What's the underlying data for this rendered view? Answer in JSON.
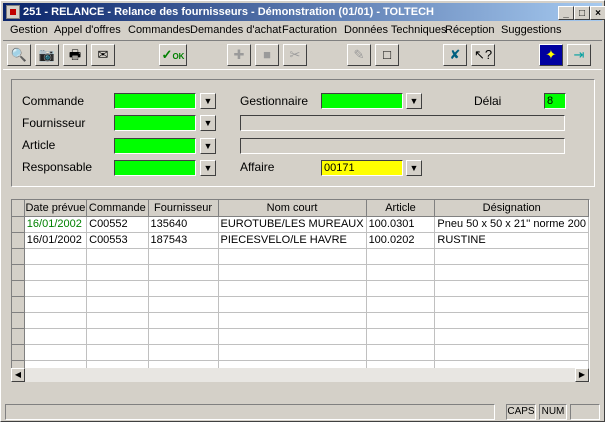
{
  "window": {
    "title": "251 - RELANCE - Relance des fournisseurs - Démonstration (01/01) - TOLTECH"
  },
  "menu": [
    "Gestion",
    "Appel d'offres",
    "Commandes",
    "Demandes d'achat",
    "Facturation",
    "Données Techniques",
    "Réception",
    "Suggestions"
  ],
  "toolbar": {
    "icons": [
      "preview-icon",
      "camera-icon",
      "print-icon",
      "mail-icon",
      "ok-icon",
      "add-icon",
      "stop-icon",
      "cut-icon",
      "edit-icon",
      "new-icon",
      "tools-icon",
      "help-icon",
      "scene-icon",
      "exit-icon"
    ],
    "ok_label": "OK"
  },
  "form": {
    "commande_label": "Commande",
    "fournisseur_label": "Fournisseur",
    "article_label": "Article",
    "responsable_label": "Responsable",
    "gestionnaire_label": "Gestionnaire",
    "affaire_label": "Affaire",
    "affaire_value": "00171",
    "delai_label": "Délai",
    "delai_value": "8"
  },
  "table": {
    "columns": [
      "Date prévue",
      "Commande",
      "Fournisseur",
      "Nom court",
      "Article",
      "Désignation"
    ],
    "rows": [
      [
        "16/01/2002",
        "C00552",
        "135640",
        "EUROTUBE/LES MUREAUX",
        "100.0301",
        "Pneu 50 x 50 x 21'' norme 200"
      ],
      [
        "16/01/2002",
        "C00553",
        "187543",
        "PIECESVELO/LE HAVRE",
        "100.0202",
        "RUSTINE"
      ]
    ]
  },
  "status": {
    "caps": "CAPS",
    "num": "NUM"
  },
  "colors": {
    "title_start": "#0a246a",
    "required_field": "#00ff00",
    "affaire_field": "#ffff00",
    "first_date": "#008000"
  }
}
